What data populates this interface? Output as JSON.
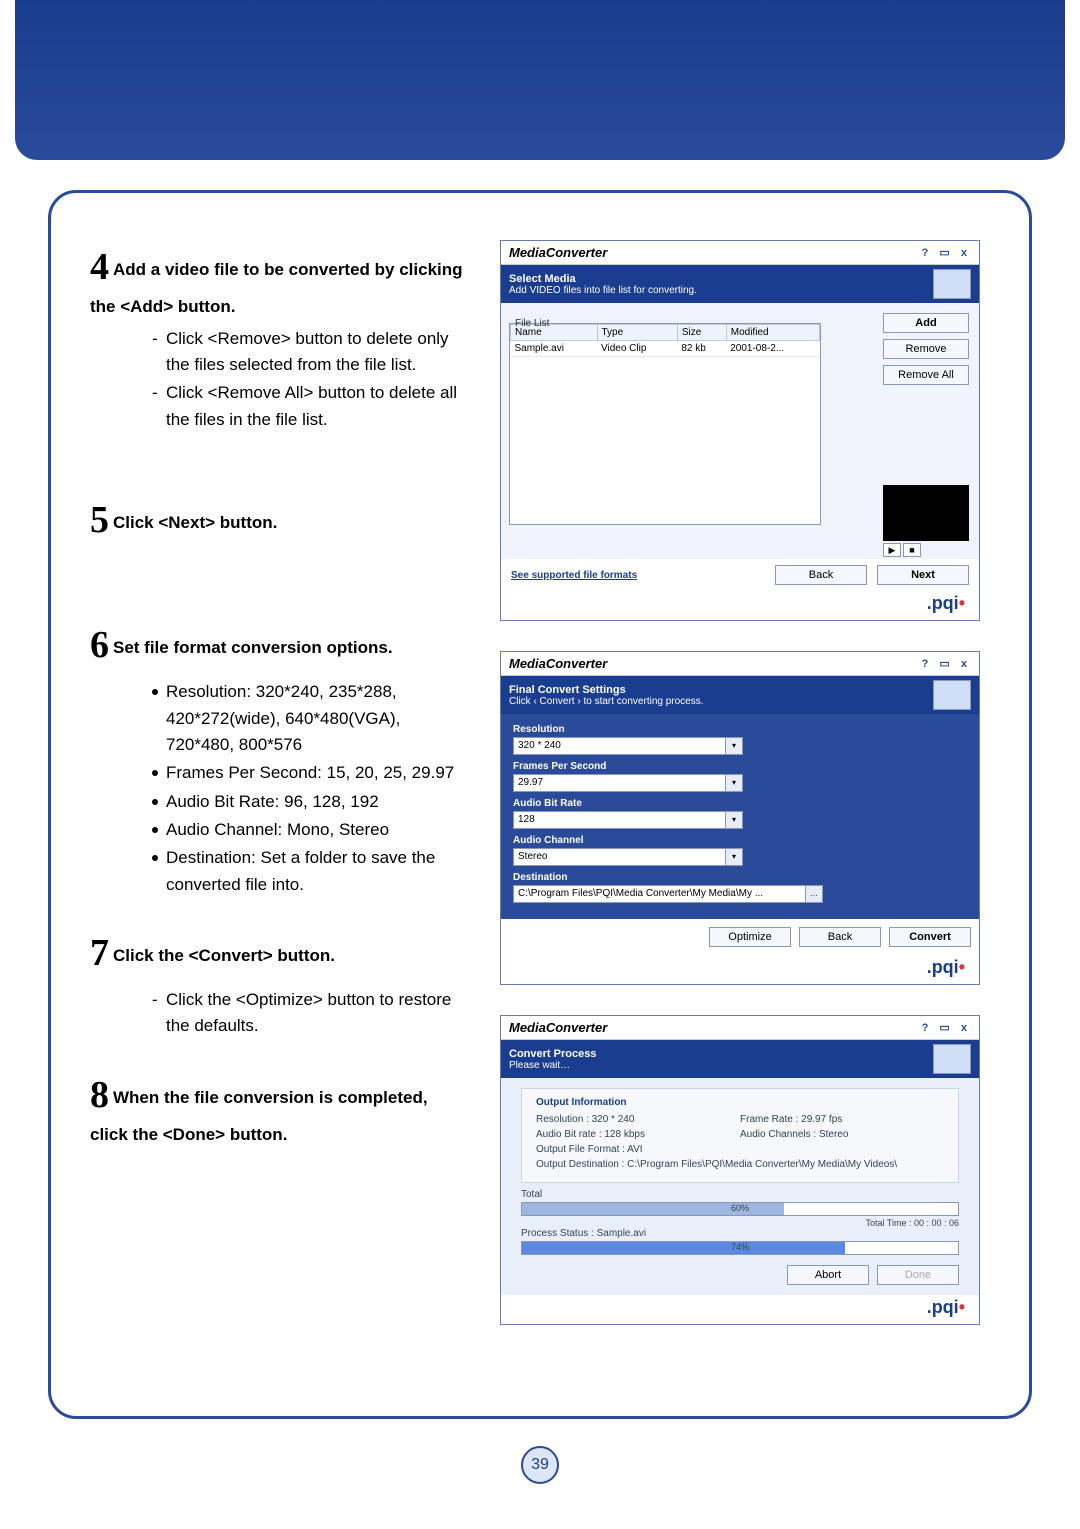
{
  "page_number": "39",
  "brand": ".pqi",
  "steps": {
    "s4": {
      "num": "4",
      "title": "Add a video file to be converted by clicking the <Add> button.",
      "items": [
        "Click <Remove> button to delete only the files selected from the file list.",
        "Click <Remove All> button to delete all the files in the file list."
      ]
    },
    "s5": {
      "num": "5",
      "title": "Click <Next> button."
    },
    "s6": {
      "num": "6",
      "title": "Set file format conversion options.",
      "items": [
        "Resolution: 320*240, 235*288, 420*272(wide), 640*480(VGA), 720*480, 800*576",
        "Frames Per Second: 15, 20, 25, 29.97",
        "Audio Bit Rate: 96, 128, 192",
        "Audio Channel: Mono, Stereo",
        "Destination: Set a folder to save the converted file into."
      ]
    },
    "s7": {
      "num": "7",
      "title": "Click the <Convert> button.",
      "items": [
        "Click the <Optimize> button to restore the defaults."
      ]
    },
    "s8": {
      "num": "8",
      "title": "When the file conversion is completed, click the <Done> button."
    }
  },
  "app1": {
    "title": "MediaConverter",
    "win_ctrl": "?  ▭  x",
    "section": "Select Media",
    "hint": "Add VIDEO files into file list for converting.",
    "file_list_label": "File List",
    "cols": {
      "name": "Name",
      "type": "Type",
      "size": "Size",
      "modified": "Modified"
    },
    "row": {
      "name": "Sample.avi",
      "type": "Video Clip",
      "size": "82 kb",
      "modified": "2001-08-2..."
    },
    "btn_add": "Add",
    "btn_remove": "Remove",
    "btn_remove_all": "Remove All",
    "link": "See supported file formats",
    "btn_back": "Back",
    "btn_next": "Next"
  },
  "app2": {
    "title": "MediaConverter",
    "win_ctrl": "?  ▭  x",
    "section": "Final Convert Settings",
    "hint": "Click  ‹ Convert ›  to start converting process.",
    "lab_res": "Resolution",
    "val_res": "320 * 240",
    "lab_fps": "Frames Per Second",
    "val_fps": "29.97",
    "lab_abr": "Audio Bit Rate",
    "val_abr": "128",
    "lab_ach": "Audio Channel",
    "val_ach": "Stereo",
    "lab_dest": "Destination",
    "val_dest": "C:\\Program Files\\PQI\\Media Converter\\My Media\\My ...",
    "btn_optimize": "Optimize",
    "btn_back": "Back",
    "btn_convert": "Convert"
  },
  "app3": {
    "title": "MediaConverter",
    "win_ctrl": "?  ▭  x",
    "section": "Convert Process",
    "hint": "Please wait…",
    "out_hd": "Output Information",
    "res": "Resolution : 320 * 240",
    "fps": "Frame Rate : 29.97 fps",
    "abr": "Audio Bit rate : 128 kbps",
    "ach": "Audio Channels : Stereo",
    "fmt": "Output File Format : AVI",
    "dest": "Output Destination : C:\\Program Files\\PQI\\Media Converter\\My Media\\My Videos\\",
    "total_label": "Total",
    "total_pct": "60%",
    "total_time": "Total Time : 00 : 00 : 06",
    "proc_status": "Process Status : Sample.avi",
    "proc_pct": "74%",
    "btn_abort": "Abort",
    "btn_done": "Done"
  }
}
